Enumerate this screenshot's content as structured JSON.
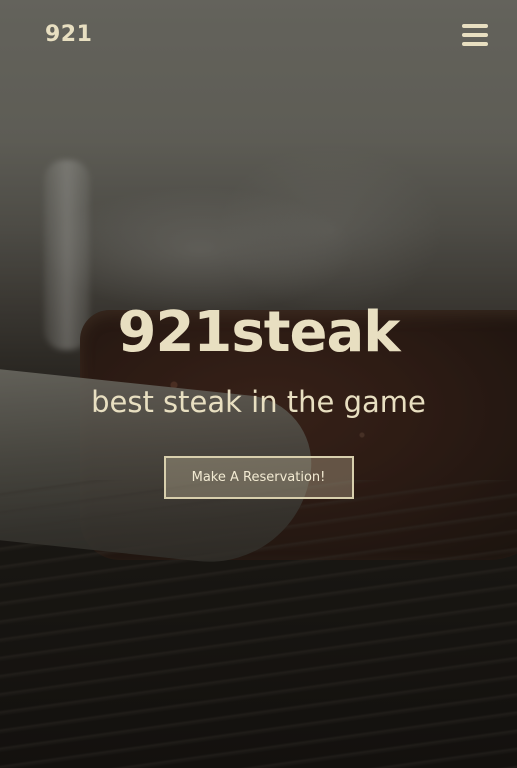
{
  "header": {
    "brand": "921",
    "menu_icon": "hamburger-menu-icon"
  },
  "hero": {
    "title": "921steak",
    "subtitle": "best steak in the game",
    "cta_label": "Make A Reservation!"
  },
  "colors": {
    "text": "#e8dfc1",
    "button_border": "#d8cfad",
    "button_fill": "rgba(200,190,160,0.35)"
  }
}
